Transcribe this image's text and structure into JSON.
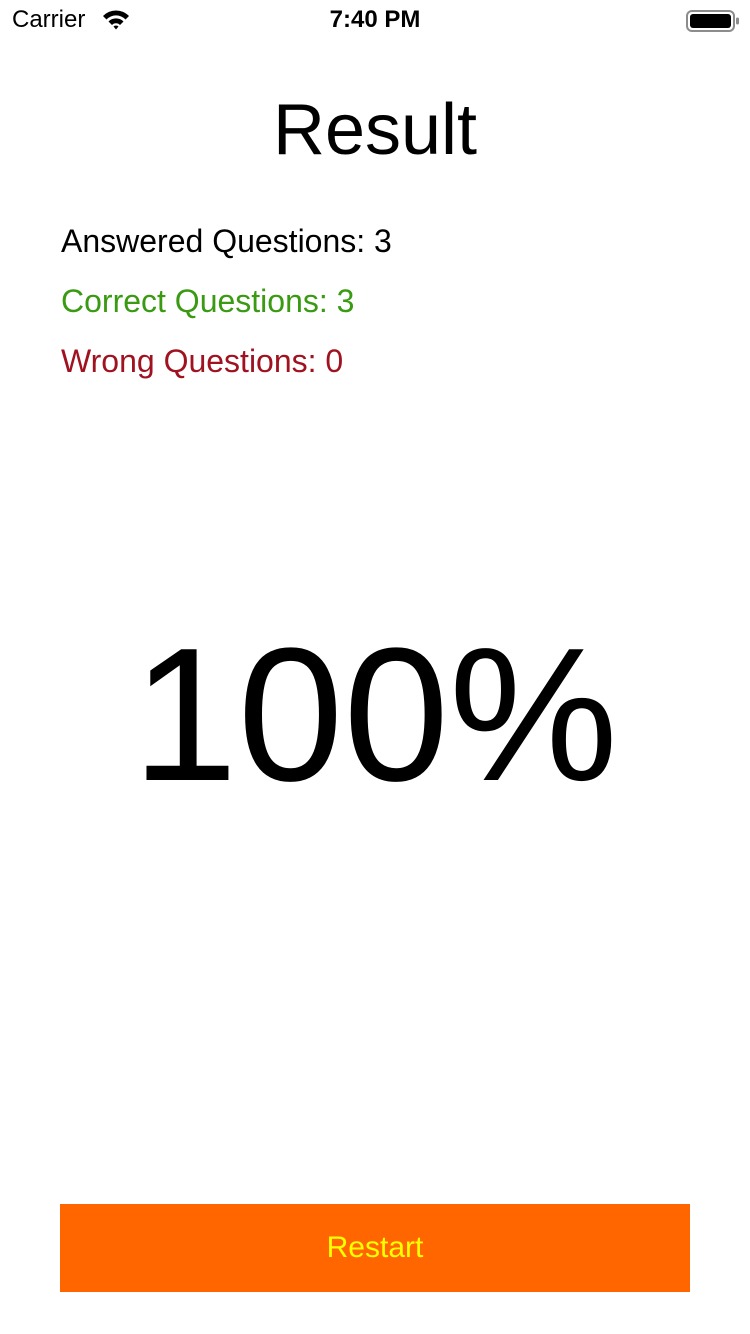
{
  "status_bar": {
    "carrier": "Carrier",
    "time": "7:40 PM",
    "icons": [
      "wifi-icon",
      "battery-icon"
    ]
  },
  "title": "Result",
  "stats": {
    "answered": "Answered Questions: 3",
    "correct": "Correct Questions: 3",
    "wrong": "Wrong Questions: 0"
  },
  "score": "100%",
  "restart_button": {
    "label": "Restart"
  },
  "colors": {
    "text": "#000000",
    "correct": "#3a9a12",
    "wrong": "#a01220",
    "button_bg": "#ff6600",
    "button_text": "#ffff00"
  }
}
